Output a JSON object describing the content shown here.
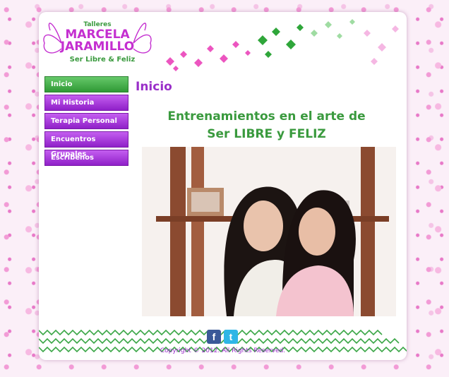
{
  "logo": {
    "line1": "Talleres",
    "line2": "MARCELA",
    "line3": "JARAMILLO",
    "tagline": "Ser Libre & Feliz"
  },
  "nav": {
    "items": [
      {
        "label": "Inicio",
        "active": true
      },
      {
        "label": "Mi Historia",
        "active": false
      },
      {
        "label": "Terapia Personal",
        "active": false
      },
      {
        "label": "Encuentros Grupales",
        "active": false
      },
      {
        "label": "Escríbenos",
        "active": false
      }
    ]
  },
  "main": {
    "title": "Inicio",
    "headline_line1": "Entrenamientos en el arte de",
    "headline_line2": "Ser LIBRE y FELIZ"
  },
  "footer": {
    "facebook_glyph": "f",
    "twitter_glyph": "t",
    "copyright": "Copyright © 2012. All Rights Reserved."
  },
  "colors": {
    "purple": "#9a2fc9",
    "green": "#3a9a3e",
    "pink": "#e83fb3"
  }
}
